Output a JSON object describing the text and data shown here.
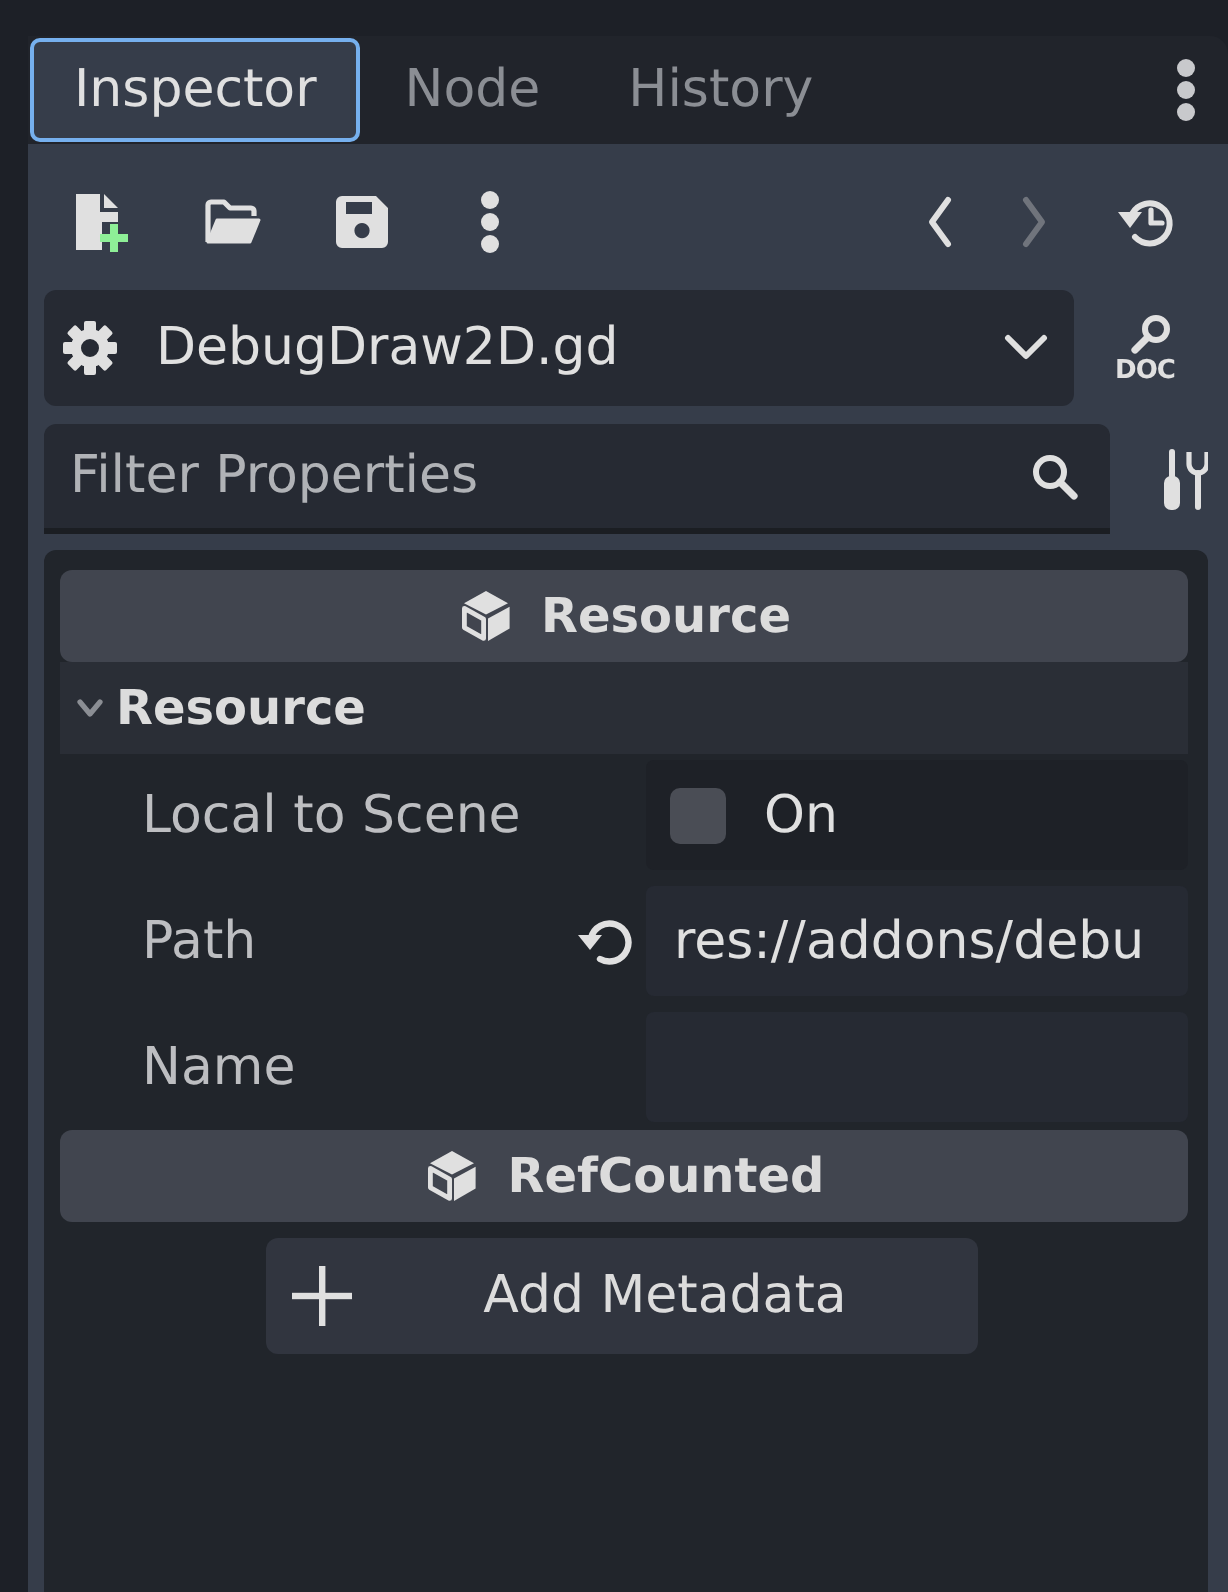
{
  "tabs": [
    {
      "label": "Inspector",
      "selected": true
    },
    {
      "label": "Node",
      "selected": false
    },
    {
      "label": "History",
      "selected": false
    }
  ],
  "toolbar": {
    "back": {
      "disabled": false
    },
    "forward": {
      "disabled": true
    }
  },
  "object_selector": {
    "value": "DebugDraw2D.gd",
    "doc_label": "DOC"
  },
  "filter": {
    "placeholder": "Filter Properties"
  },
  "categories": [
    {
      "title": "Resource",
      "sections": [
        {
          "title": "Resource",
          "expanded": true,
          "properties": [
            {
              "kind": "checkbox",
              "label": "Local to Scene",
              "checked": false,
              "text": "On",
              "revertible": false
            },
            {
              "kind": "text",
              "label": "Path",
              "value": "res://addons/debu",
              "revertible": true
            },
            {
              "kind": "text",
              "label": "Name",
              "revertible": false
            }
          ]
        }
      ]
    },
    {
      "title": "RefCounted"
    }
  ],
  "add_metadata_button": {
    "label": "Add Metadata"
  }
}
